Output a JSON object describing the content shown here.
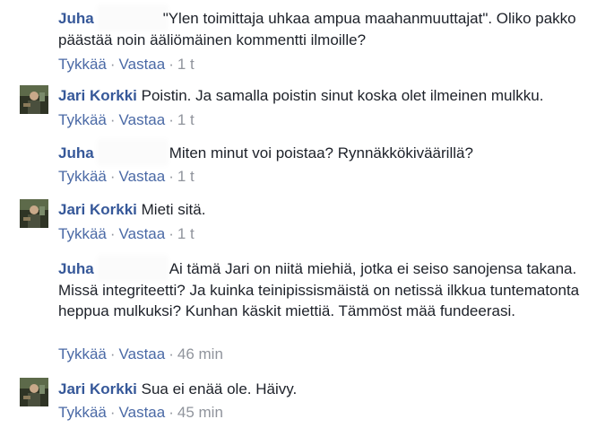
{
  "comments": [
    {
      "author": "Juha",
      "text": "\"Ylen toimittaja uhkaa ampua maahanmuuttajat\". Oliko pakko päästää noin ääliömäinen kommentti ilmoille?",
      "like": "Tykkää",
      "reply": "Vastaa",
      "time": "1 t"
    },
    {
      "author": "Jari Korkki",
      "text": "Poistin. Ja samalla poistin sinut koska olet ilmeinen mulkku.",
      "like": "Tykkää",
      "reply": "Vastaa",
      "time": "1 t"
    },
    {
      "author": "Juha",
      "text": "Miten minut voi poistaa? Rynnäkkökiväärillä?",
      "like": "Tykkää",
      "reply": "Vastaa",
      "time": "1 t"
    },
    {
      "author": "Jari Korkki",
      "text": "Mieti sitä.",
      "like": "Tykkää",
      "reply": "Vastaa",
      "time": "1 t"
    },
    {
      "author": "Juha",
      "text": "Ai tämä Jari on niitä miehiä, jotka ei seiso sanojensa takana. Missä integriteetti? Ja kuinka teinipissismäistä on netissä ilkkua tuntematonta heppua mulkuksi? Kunhan käskit miettiä. Tämmöst mää fundeerasi.",
      "like": "Tykkää",
      "reply": "Vastaa",
      "time": "46 min"
    },
    {
      "author": "Jari Korkki",
      "text": "Sua ei enää ole. Häivy.",
      "like": "Tykkää",
      "reply": "Vastaa",
      "time": "45 min"
    }
  ],
  "separator": "·",
  "colors": {
    "author": "#365899",
    "body": "#1d2129",
    "meta": "#90949c",
    "action_link": "#4b6aa6"
  },
  "icons": {
    "avatar_jari": "avatar-photo"
  }
}
